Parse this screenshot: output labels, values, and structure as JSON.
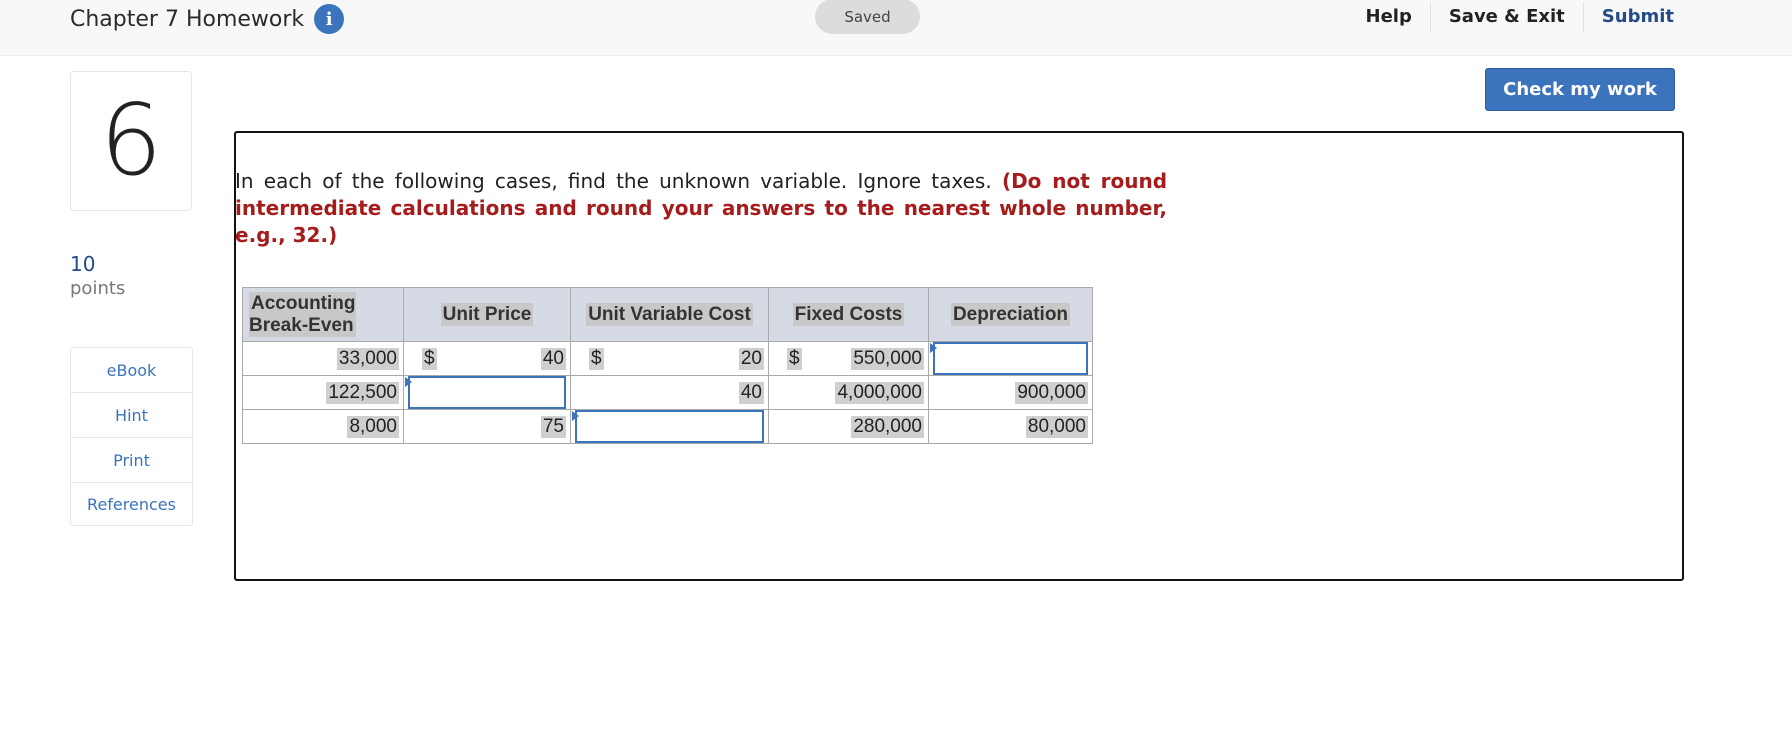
{
  "header": {
    "title": "Chapter 7 Homework",
    "info_icon": "info-icon",
    "status": "Saved",
    "links": [
      "Help",
      "Save & Exit",
      "Submit"
    ]
  },
  "question": {
    "number": "6",
    "points_value": "10",
    "points_label": "points"
  },
  "side_tools": [
    "eBook",
    "Hint",
    "Print",
    "References"
  ],
  "check_button": "Check my work",
  "prompt": {
    "text": "In each of the following cases, find the unknown variable. Ignore taxes.",
    "emphasis": "(Do not round intermediate calculations and round your answers to the nearest whole number, e.g., 32.)"
  },
  "table": {
    "headers": [
      "Accounting Break-Even",
      "Unit Price",
      "Unit Variable Cost",
      "Fixed Costs",
      "Depreciation"
    ],
    "currency": "$",
    "rows": [
      {
        "break_even": "33,000",
        "unit_price": "40",
        "unit_variable_cost": "20",
        "fixed_costs": "550,000",
        "depreciation": ""
      },
      {
        "break_even": "122,500",
        "unit_price": "",
        "unit_variable_cost": "40",
        "fixed_costs": "4,000,000",
        "depreciation": "900,000"
      },
      {
        "break_even": "8,000",
        "unit_price": "75",
        "unit_variable_cost": "",
        "fixed_costs": "280,000",
        "depreciation": "80,000"
      }
    ]
  },
  "colors": {
    "accent": "#3b74bd",
    "emphasis": "#a61c1c",
    "header_bg": "#d5dae4"
  }
}
